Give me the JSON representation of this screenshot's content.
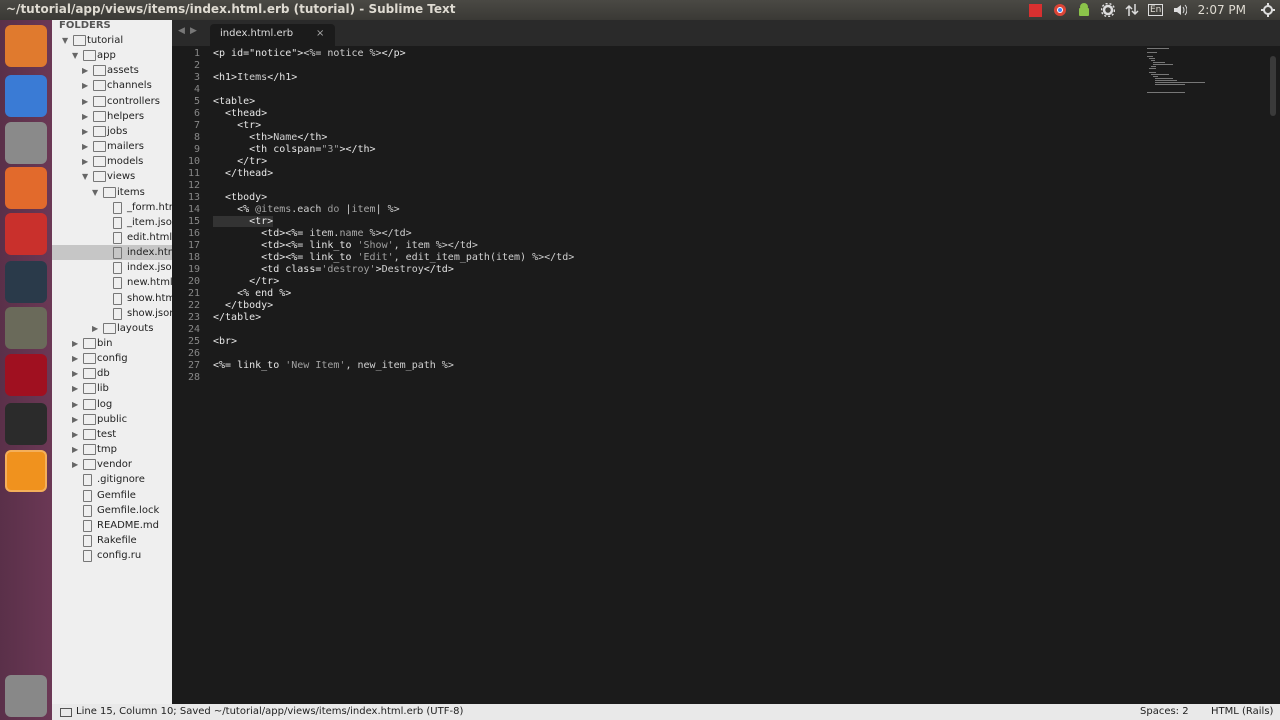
{
  "window": {
    "title": "~/tutorial/app/views/items/index.html.erb (tutorial) - Sublime Text"
  },
  "tray": {
    "keyboard_layout": "En",
    "clock": "2:07 PM"
  },
  "sidebar": {
    "header": "FOLDERS",
    "rows": [
      {
        "label": "tutorial",
        "type": "folder",
        "arrow": "▼",
        "depth": 0
      },
      {
        "label": "app",
        "type": "folder",
        "arrow": "▼",
        "depth": 1
      },
      {
        "label": "assets",
        "type": "folder",
        "arrow": "▶",
        "depth": 2
      },
      {
        "label": "channels",
        "type": "folder",
        "arrow": "▶",
        "depth": 2
      },
      {
        "label": "controllers",
        "type": "folder",
        "arrow": "▶",
        "depth": 2
      },
      {
        "label": "helpers",
        "type": "folder",
        "arrow": "▶",
        "depth": 2
      },
      {
        "label": "jobs",
        "type": "folder",
        "arrow": "▶",
        "depth": 2
      },
      {
        "label": "mailers",
        "type": "folder",
        "arrow": "▶",
        "depth": 2
      },
      {
        "label": "models",
        "type": "folder",
        "arrow": "▶",
        "depth": 2
      },
      {
        "label": "views",
        "type": "folder",
        "arrow": "▼",
        "depth": 2
      },
      {
        "label": "items",
        "type": "folder",
        "arrow": "▼",
        "depth": 3
      },
      {
        "label": "_form.htm",
        "type": "file",
        "arrow": "",
        "depth": 4
      },
      {
        "label": "_item.json",
        "type": "file",
        "arrow": "",
        "depth": 4
      },
      {
        "label": "edit.html.",
        "type": "file",
        "arrow": "",
        "depth": 4
      },
      {
        "label": "index.htm",
        "type": "file",
        "arrow": "",
        "depth": 4,
        "selected": true
      },
      {
        "label": "index.json",
        "type": "file",
        "arrow": "",
        "depth": 4
      },
      {
        "label": "new.html.",
        "type": "file",
        "arrow": "",
        "depth": 4
      },
      {
        "label": "show.html",
        "type": "file",
        "arrow": "",
        "depth": 4
      },
      {
        "label": "show.json",
        "type": "file",
        "arrow": "",
        "depth": 4
      },
      {
        "label": "layouts",
        "type": "folder",
        "arrow": "▶",
        "depth": 3
      },
      {
        "label": "bin",
        "type": "folder",
        "arrow": "▶",
        "depth": 1
      },
      {
        "label": "config",
        "type": "folder",
        "arrow": "▶",
        "depth": 1
      },
      {
        "label": "db",
        "type": "folder",
        "arrow": "▶",
        "depth": 1
      },
      {
        "label": "lib",
        "type": "folder",
        "arrow": "▶",
        "depth": 1
      },
      {
        "label": "log",
        "type": "folder",
        "arrow": "▶",
        "depth": 1
      },
      {
        "label": "public",
        "type": "folder",
        "arrow": "▶",
        "depth": 1
      },
      {
        "label": "test",
        "type": "folder",
        "arrow": "▶",
        "depth": 1
      },
      {
        "label": "tmp",
        "type": "folder",
        "arrow": "▶",
        "depth": 1
      },
      {
        "label": "vendor",
        "type": "folder",
        "arrow": "▶",
        "depth": 1
      },
      {
        "label": ".gitignore",
        "type": "file",
        "arrow": "",
        "depth": 1
      },
      {
        "label": "Gemfile",
        "type": "file",
        "arrow": "",
        "depth": 1
      },
      {
        "label": "Gemfile.lock",
        "type": "file",
        "arrow": "",
        "depth": 1
      },
      {
        "label": "README.md",
        "type": "file",
        "arrow": "",
        "depth": 1
      },
      {
        "label": "Rakefile",
        "type": "file",
        "arrow": "",
        "depth": 1
      },
      {
        "label": "config.ru",
        "type": "file",
        "arrow": "",
        "depth": 1
      }
    ]
  },
  "tab": {
    "label": "index.html.erb",
    "close": "×"
  },
  "code": [
    [
      [
        "t",
        "<p id=\"notice\">"
      ],
      [
        "a",
        "<%= notice %>"
      ],
      [
        "t",
        "</p>"
      ]
    ],
    [],
    [
      [
        "t",
        "<h1>"
      ],
      [
        "a",
        "Items"
      ],
      [
        "t",
        "</h1>"
      ]
    ],
    [],
    [
      [
        "t",
        "<table>"
      ]
    ],
    [
      [
        "t",
        "  <thead>"
      ]
    ],
    [
      [
        "t",
        "    <tr>"
      ]
    ],
    [
      [
        "t",
        "      <th>"
      ],
      [
        "a",
        "Name"
      ],
      [
        "t",
        "</th>"
      ]
    ],
    [
      [
        "t",
        "      <th colspan="
      ],
      [
        "s",
        "\"3\""
      ],
      [
        "t",
        "></th>"
      ]
    ],
    [
      [
        "t",
        "    </tr>"
      ]
    ],
    [
      [
        "t",
        "  </thead>"
      ]
    ],
    [],
    [
      [
        "t",
        "  <tbody>"
      ]
    ],
    [
      [
        "t",
        "    <% "
      ],
      [
        "v",
        "@items"
      ],
      [
        "a",
        ".each "
      ],
      [
        "k",
        "do"
      ],
      [
        "a",
        " |"
      ],
      [
        "v",
        "item"
      ],
      [
        "a",
        "| %>"
      ]
    ],
    [
      [
        "t",
        "      <tr>"
      ]
    ],
    [
      [
        "t",
        "        <td><%= "
      ],
      [
        "a",
        "item."
      ],
      [
        "v",
        "name"
      ],
      [
        "a",
        " %></td>"
      ]
    ],
    [
      [
        "t",
        "        <td><%= link_to "
      ],
      [
        "s",
        "'Show'"
      ],
      [
        "a",
        ", item %></td>"
      ]
    ],
    [
      [
        "t",
        "        <td><%= link_to "
      ],
      [
        "s",
        "'Edit'"
      ],
      [
        "a",
        ", edit_item_path(item) %></td>"
      ]
    ],
    [
      [
        "t",
        "        <td class="
      ],
      [
        "s",
        "'destroy'"
      ],
      [
        "t",
        ">"
      ],
      [
        "a",
        "Destroy"
      ],
      [
        "t",
        "</td>"
      ]
    ],
    [
      [
        "t",
        "      </tr>"
      ]
    ],
    [
      [
        "t",
        "    <% end %>"
      ]
    ],
    [
      [
        "t",
        "  </tbody>"
      ]
    ],
    [
      [
        "t",
        "</table>"
      ]
    ],
    [],
    [
      [
        "t",
        "<br>"
      ]
    ],
    [],
    [
      [
        "t",
        "<%= link_to "
      ],
      [
        "s",
        "'New Item'"
      ],
      [
        "a",
        ", new_item_path %>"
      ]
    ],
    []
  ],
  "status": {
    "left": "Line 15, Column 10; Saved ~/tutorial/app/views/items/index.html.erb (UTF-8)",
    "spaces": "Spaces: 2",
    "syntax": "HTML (Rails)"
  },
  "launcher": [
    {
      "name": "ubuntu-dash-icon",
      "color": "#e07a2e"
    },
    {
      "name": "chrome-icon",
      "color": "#3a7bd5"
    },
    {
      "name": "file-manager-icon",
      "color": "#8a8a8a"
    },
    {
      "name": "software-center-icon",
      "color": "#e26a2c"
    },
    {
      "name": "settings-icon",
      "color": "#c9302c"
    },
    {
      "name": "steam-icon",
      "color": "#2a3a4a"
    },
    {
      "name": "gimp-icon",
      "color": "#6a6a5a"
    },
    {
      "name": "app-icon",
      "color": "#a01020"
    },
    {
      "name": "terminal-icon",
      "color": "#2b2b2b"
    },
    {
      "name": "sublime-text-icon",
      "color": "#f0921e"
    },
    {
      "name": "trash-icon",
      "color": "#888888"
    }
  ]
}
